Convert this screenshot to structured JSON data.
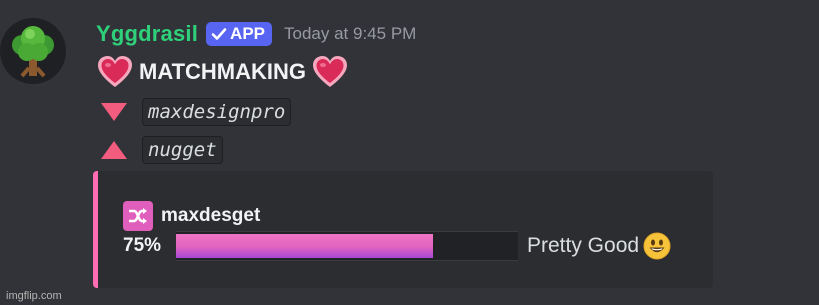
{
  "message": {
    "author": "Yggdrasil",
    "badge": "APP",
    "timestamp": "Today at 9:45 PM",
    "title": "MATCHMAKING",
    "avatar_icon": "tree-icon",
    "down_user": "maxdesignpro",
    "up_user": "nugget"
  },
  "embed": {
    "author_name": "maxdesget",
    "author_icon": "shuffle-icon",
    "percent_label": "75%",
    "progress": 0.75,
    "rating": "Pretty Good",
    "accent_color": "#ff6cb4"
  },
  "watermark": "imgflip.com",
  "colors": {
    "username": "#2fd07a",
    "badge": "#5865f2",
    "background": "#313338",
    "embed_bg": "#2b2d31"
  }
}
